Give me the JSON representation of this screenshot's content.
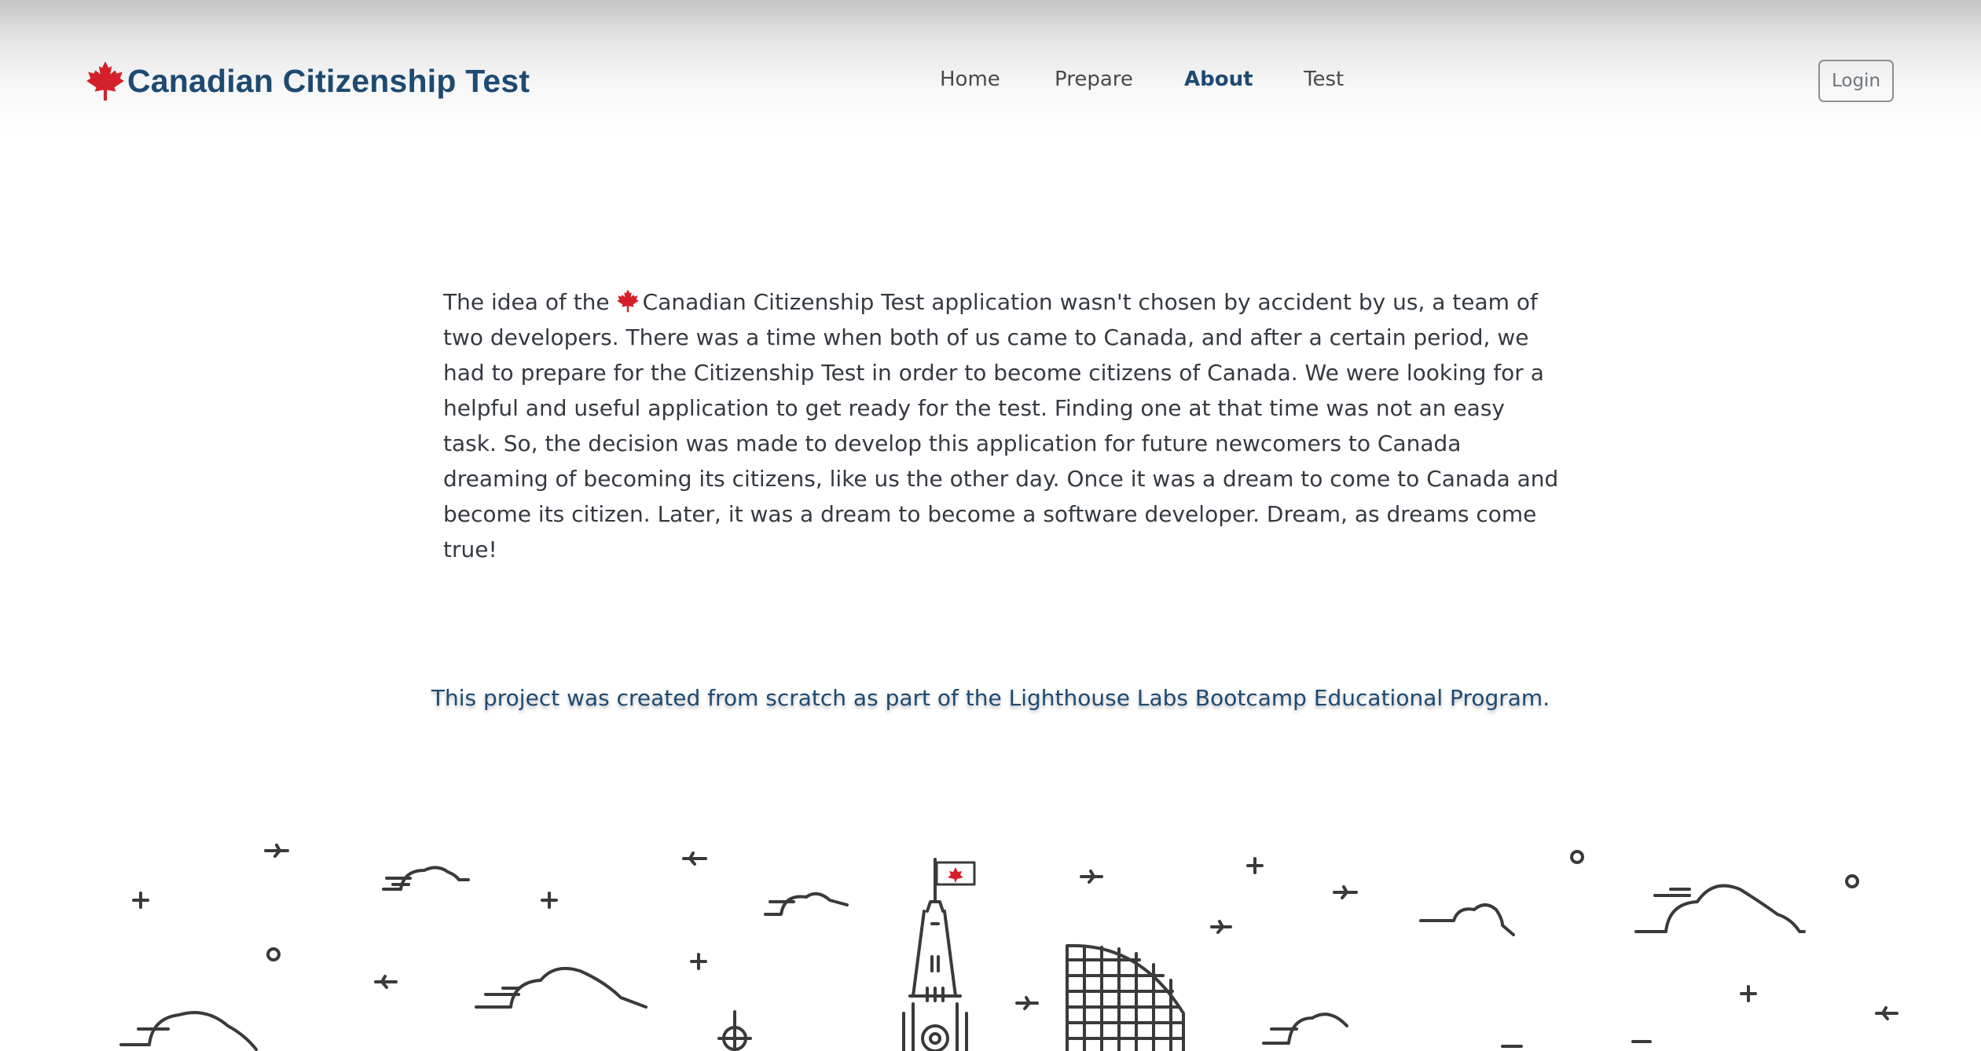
{
  "header": {
    "brand_title": "Canadian Citizenship Test",
    "brand_icon": "maple-leaf-icon",
    "nav": [
      {
        "label": "Home",
        "active": false
      },
      {
        "label": "Prepare",
        "active": false
      },
      {
        "label": "About",
        "active": true
      },
      {
        "label": "Test",
        "active": false
      }
    ],
    "login_label": "Login"
  },
  "main": {
    "intro_before_icon": "The idea of the",
    "intro_after_icon": "Canadian Citizenship Test application wasn't chosen by accident by us, a team of two developers. There was a time when both of us came to Canada, and after a certain period, we had to prepare for the Citizenship Test in order to become citizens of Canada. We were looking for a helpful and useful application to get ready for the test. Finding one at that time was not an easy task. So, the decision was made to develop this application for future newcomers to Canada dreaming of becoming its citizens, like us the other day. Once it was a dream to come to Canada and become its citizen. Later, it was a dream to become a software developer. Dream, as dreams come true!",
    "credit": "This project was created from scratch as part of the Lighthouse Labs Bootcamp Educational Program."
  },
  "colors": {
    "brand": "#1e4a72",
    "maple_red": "#d3202a",
    "text": "#343a40"
  }
}
